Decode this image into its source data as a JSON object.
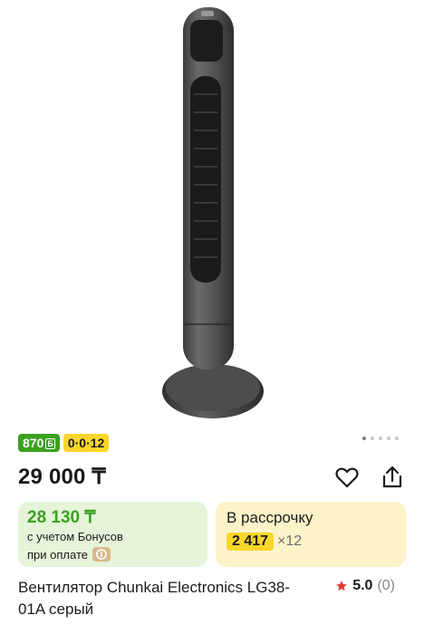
{
  "product": {
    "bonus_badge": "870",
    "bonus_badge_currency": "Б",
    "installment_badge": "0·0·12",
    "price": "29 000 ₸",
    "bonus_card": {
      "price": "28 130 ₸",
      "line1": "с учетом Бонусов",
      "line2": "при оплате"
    },
    "installment_card": {
      "title": "В рассрочку",
      "amount": "2 417",
      "multiplier": "×12"
    },
    "title": "Вентилятор Chunkai Electronics LG38-01A серый",
    "rating": {
      "score": "5.0",
      "count": "(0)"
    },
    "gallery": {
      "total_images": 5,
      "active_index": 0
    }
  },
  "colors": {
    "bonus_green": "#3aa11f",
    "installment_yellow": "#f9d62a",
    "star_red": "#e03a2f"
  }
}
